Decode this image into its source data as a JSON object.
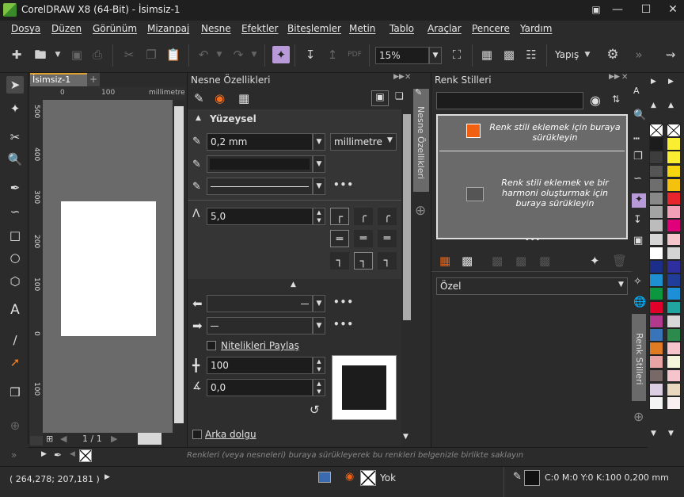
{
  "window": {
    "title": "CorelDRAW X8 (64-Bit) - İsimsiz-1"
  },
  "menu": [
    "Dosya",
    "Düzen",
    "Görünüm",
    "Mizanpaj",
    "Nesne",
    "Efektler",
    "Biteşlemler",
    "Metin",
    "Tablo",
    "Araçlar",
    "Pencere",
    "Yardım"
  ],
  "toolbar": {
    "zoom": "15%",
    "snap_label": "Yapış"
  },
  "document": {
    "tab": "İsimsiz-1",
    "ruler_unit": "millimetre",
    "h_ticks": [
      "0",
      "100"
    ],
    "v_ticks": [
      "500",
      "400",
      "300",
      "200",
      "100",
      "0",
      "100"
    ],
    "page_nav": "1 / 1"
  },
  "object_props": {
    "title": "Nesne Özellikleri",
    "section": "Yüzeysel",
    "width_value": "0,2 mm",
    "unit": "millimetre",
    "miter_value": "5,0",
    "share_attrs": "Nitelikleri Paylaş",
    "stretch_value": "100",
    "angle_value": "0,0",
    "bg_fill": "Arka dolgu",
    "side_tab": "Nesne Özellikleri"
  },
  "color_styles": {
    "title": "Renk Stilleri",
    "drop1": "Renk stili eklemek için buraya sürükleyin",
    "drop2": "Renk stili eklemek ve bir harmoni oluşturmak için buraya sürükleyin",
    "filter": "Özel",
    "side_tab": "Renk Stilleri"
  },
  "colorbar": {
    "hint": "Renkleri (veya nesneleri) buraya sürükleyerek bu renkleri belgenizle birlikte saklayın"
  },
  "status": {
    "coords": "( 264,278; 207,181 )",
    "fill": "Yok",
    "outline": "C:0 M:0 Y:0 K:100  0,200 mm"
  },
  "palette": {
    "left": [
      "#ffffff",
      "#1c1c1c",
      "#3d3d3d",
      "#555555",
      "#6e6e6e",
      "#888888",
      "#a3a3a3",
      "#bcbcbc",
      "#d6d6d6",
      "#ffffff",
      "#1b2f8a",
      "#1e8fd0",
      "#0d9640",
      "#e0002a",
      "#b23a8c",
      "#3a74b8",
      "#e07b24",
      "#e8a4a4",
      "#786868",
      "#dccfe3",
      "#f4f4f4"
    ],
    "right": [
      "#ffffff",
      "#f9ee2f",
      "#f9ee2f",
      "#f6d60f",
      "#f4c20d",
      "#e8252c",
      "#f2a0b8",
      "#e0007a",
      "#f5c4cc",
      "#d4d4d4",
      "#2e2e9e",
      "#1f3d99",
      "#1c8fd6",
      "#21a5a0",
      "#d8d8d8",
      "#2b8a4c",
      "#f5c4cc",
      "#f5f5dc",
      "#f5c4cc",
      "#e8d8c0",
      "#f8f0f0"
    ]
  }
}
